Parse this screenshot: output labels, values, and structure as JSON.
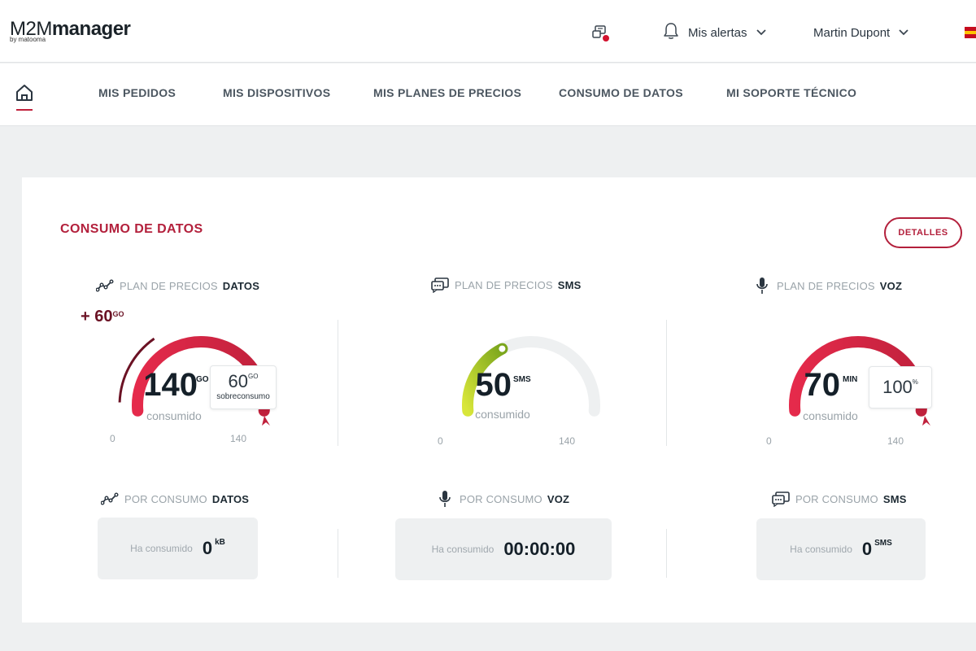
{
  "header": {
    "logo_main_a": "M2M",
    "logo_main_b": "manager",
    "logo_sub": "by matooma",
    "support_icon": "support-chat-icon",
    "alerts_label": "Mis alertas",
    "user_name": "Martin Dupont",
    "language_flag": "flag-es-icon",
    "colors": {
      "accent": "#b3203c",
      "notification_dot": "#d2122e"
    }
  },
  "nav": {
    "home_icon": "home-icon",
    "items": [
      {
        "label": "MIS PEDIDOS"
      },
      {
        "label": "MIS DISPOSITIVOS"
      },
      {
        "label": "MIS PLANES DE PRECIOS"
      },
      {
        "label": "CONSUMO DE DATOS"
      },
      {
        "label": "MI SOPORTE TÉCNICO"
      }
    ]
  },
  "card": {
    "title": "CONSUMO DE DATOS",
    "details_label": "DETALLES",
    "plans": [
      {
        "prefix": "PLAN DE PRECIOS",
        "type": "DATOS",
        "icon": "data-trend-icon",
        "value": "140",
        "unit": "GO",
        "sub": "consumido",
        "min": "0",
        "max": "140",
        "fill_fraction": 1.0,
        "over_prefix": "+ 60",
        "over_unit": "GO",
        "badge_value": "60",
        "badge_unit": "GO",
        "badge_caption": "sobreconsumo"
      },
      {
        "prefix": "PLAN DE PRECIOS",
        "type": "SMS",
        "icon": "sms-chat-icon",
        "value": "50",
        "unit": "SMS",
        "sub": "consumido",
        "min": "0",
        "max": "140",
        "fill_fraction": 0.357
      },
      {
        "prefix": "PLAN DE PRECIOS",
        "type": "VOZ",
        "icon": "microphone-icon",
        "value": "70",
        "unit": "MIN",
        "sub": "consumido",
        "min": "0",
        "max": "140",
        "fill_fraction": 1.0,
        "badge_value": "100",
        "badge_unit": "%"
      }
    ],
    "consumption": [
      {
        "prefix": "POR CONSUMO",
        "type": "DATOS",
        "icon": "data-trend-icon",
        "label": "Ha consumido",
        "value": "0",
        "unit": "kB"
      },
      {
        "prefix": "POR CONSUMO",
        "type": "VOZ",
        "icon": "microphone-icon",
        "label": "Ha consumido",
        "value": "00:00:00",
        "unit": ""
      },
      {
        "prefix": "POR CONSUMO",
        "type": "SMS",
        "icon": "sms-chat-icon",
        "label": "Ha consumido",
        "value": "0",
        "unit": "SMS"
      }
    ]
  }
}
